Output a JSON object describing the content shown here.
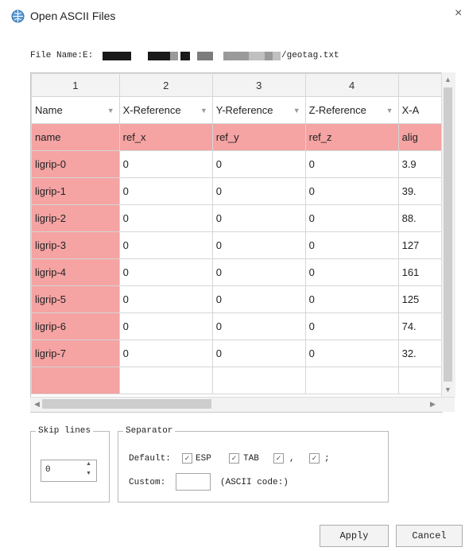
{
  "window": {
    "title": "Open ASCII Files",
    "close_glyph": "×"
  },
  "file": {
    "label_prefix": "File Name:E:",
    "suffix": "/geotag.txt"
  },
  "grid": {
    "col_numbers": [
      "1",
      "2",
      "3",
      "4",
      ""
    ],
    "headers": [
      "Name",
      "X-Reference",
      "Y-Reference",
      "Z-Reference",
      "X-A"
    ],
    "field_row": [
      "name",
      "ref_x",
      "ref_y",
      "ref_z",
      "alig"
    ],
    "rows": [
      [
        "ligrip-0",
        "0",
        "0",
        "0",
        "3.9"
      ],
      [
        "ligrip-1",
        "0",
        "0",
        "0",
        "39."
      ],
      [
        "ligrip-2",
        "0",
        "0",
        "0",
        "88."
      ],
      [
        "ligrip-3",
        "0",
        "0",
        "0",
        "127"
      ],
      [
        "ligrip-4",
        "0",
        "0",
        "0",
        "161"
      ],
      [
        "ligrip-5",
        "0",
        "0",
        "0",
        "125"
      ],
      [
        "ligrip-6",
        "0",
        "0",
        "0",
        "74."
      ],
      [
        "ligrip-7",
        "0",
        "0",
        "0",
        "32."
      ]
    ],
    "highlight_color": "#f5a3a3"
  },
  "skip_lines": {
    "legend": "Skip lines",
    "value": "0"
  },
  "separator": {
    "legend": "Separator",
    "default_label": "Default:",
    "options": [
      {
        "label": "ESP",
        "checked": true
      },
      {
        "label": "TAB",
        "checked": true
      },
      {
        "label": ",",
        "checked": true
      },
      {
        "label": ";",
        "checked": true
      }
    ],
    "custom_label": "Custom:",
    "custom_value": "",
    "ascii_code_label": "(ASCII code:)"
  },
  "buttons": {
    "apply": "Apply",
    "cancel": "Cancel"
  }
}
